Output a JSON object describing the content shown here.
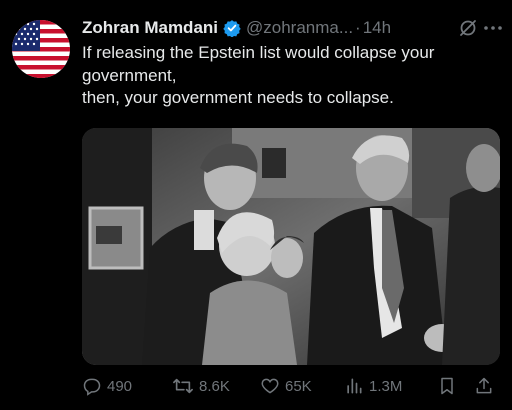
{
  "tweet": {
    "author": {
      "display_name": "Zohran Mamdani",
      "verified": true,
      "handle": "@zohranma...",
      "separator": "·",
      "time": "14h"
    },
    "text_lines": [
      "If releasing the Epstein list would collapse your",
      "government,",
      "then, your government needs to collapse."
    ],
    "actions": {
      "replies": "490",
      "reposts": "8.6K",
      "likes": "65K",
      "views": "1.3M"
    }
  },
  "icons": {
    "verified": "verified-badge-icon",
    "grok": "grok-icon",
    "more": "more-options-icon",
    "reply": "reply-icon",
    "repost": "repost-icon",
    "like": "heart-icon",
    "views": "views-chart-icon",
    "bookmark": "bookmark-icon",
    "share": "share-icon"
  },
  "colors": {
    "background": "#000000",
    "text_primary": "#e7e9ea",
    "text_secondary": "#71767b",
    "verified_blue": "#1d9bf0"
  }
}
